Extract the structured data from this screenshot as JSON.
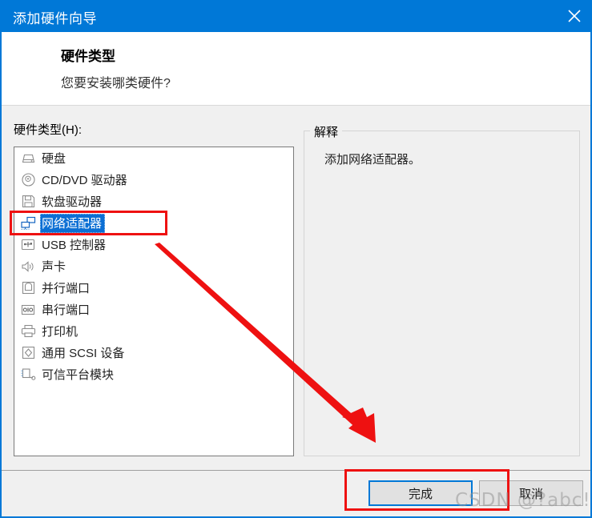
{
  "window": {
    "title": "添加硬件向导",
    "close_icon": "close-icon",
    "accent_color": "#0078d7"
  },
  "header": {
    "title": "硬件类型",
    "subtitle": "您要安装哪类硬件?"
  },
  "main": {
    "list_label": "硬件类型(H):",
    "items": [
      {
        "label": "硬盘",
        "icon": "hard-disk-icon",
        "selected": false
      },
      {
        "label": "CD/DVD 驱动器",
        "icon": "cd-dvd-icon",
        "selected": false
      },
      {
        "label": "软盘驱动器",
        "icon": "floppy-disk-icon",
        "selected": false
      },
      {
        "label": "网络适配器",
        "icon": "network-adapter-icon",
        "selected": true
      },
      {
        "label": "USB 控制器",
        "icon": "usb-controller-icon",
        "selected": false
      },
      {
        "label": "声卡",
        "icon": "sound-card-icon",
        "selected": false
      },
      {
        "label": "并行端口",
        "icon": "parallel-port-icon",
        "selected": false
      },
      {
        "label": "串行端口",
        "icon": "serial-port-icon",
        "selected": false
      },
      {
        "label": "打印机",
        "icon": "printer-icon",
        "selected": false
      },
      {
        "label": "通用 SCSI 设备",
        "icon": "scsi-device-icon",
        "selected": false
      },
      {
        "label": "可信平台模块",
        "icon": "tpm-icon",
        "selected": false
      }
    ],
    "explanation": {
      "legend": "解释",
      "text": "添加网络适配器。"
    }
  },
  "footer": {
    "finish_label": "完成",
    "cancel_label": "取消"
  },
  "annotations": {
    "color": "#ee1111",
    "watermark": "CSDN @?abc!"
  }
}
